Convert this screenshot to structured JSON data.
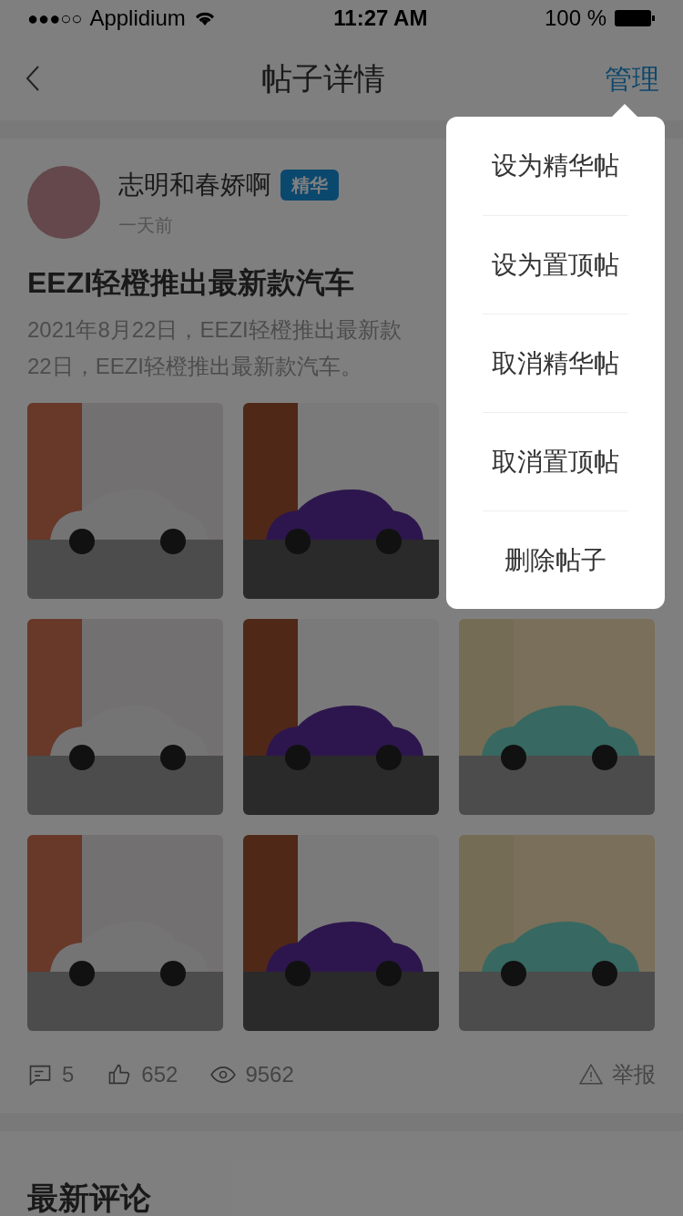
{
  "status_bar": {
    "signal": "●●●○○",
    "carrier": "Applidium",
    "time": "11:27 AM",
    "battery": "100 %"
  },
  "nav": {
    "title": "帖子详情",
    "action": "管理"
  },
  "post": {
    "author": "志明和春娇啊",
    "badge": "精华",
    "time": "一天前",
    "title": "EEZI轻橙推出最新款汽车",
    "desc_lines": [
      "2021年8月22日，EEZI轻橙推出最新款",
      "22日，EEZI轻橙推出最新款汽车。"
    ],
    "stats": [
      {
        "kind": "comment",
        "value": "5"
      },
      {
        "kind": "like",
        "value": "652"
      },
      {
        "kind": "view",
        "value": "9562"
      }
    ],
    "report": "举报"
  },
  "comments": {
    "title": "最新评论"
  },
  "menu": {
    "items": [
      "设为精华帖",
      "设为置顶帖",
      "取消精华帖",
      "取消置顶帖",
      "删除帖子"
    ]
  }
}
